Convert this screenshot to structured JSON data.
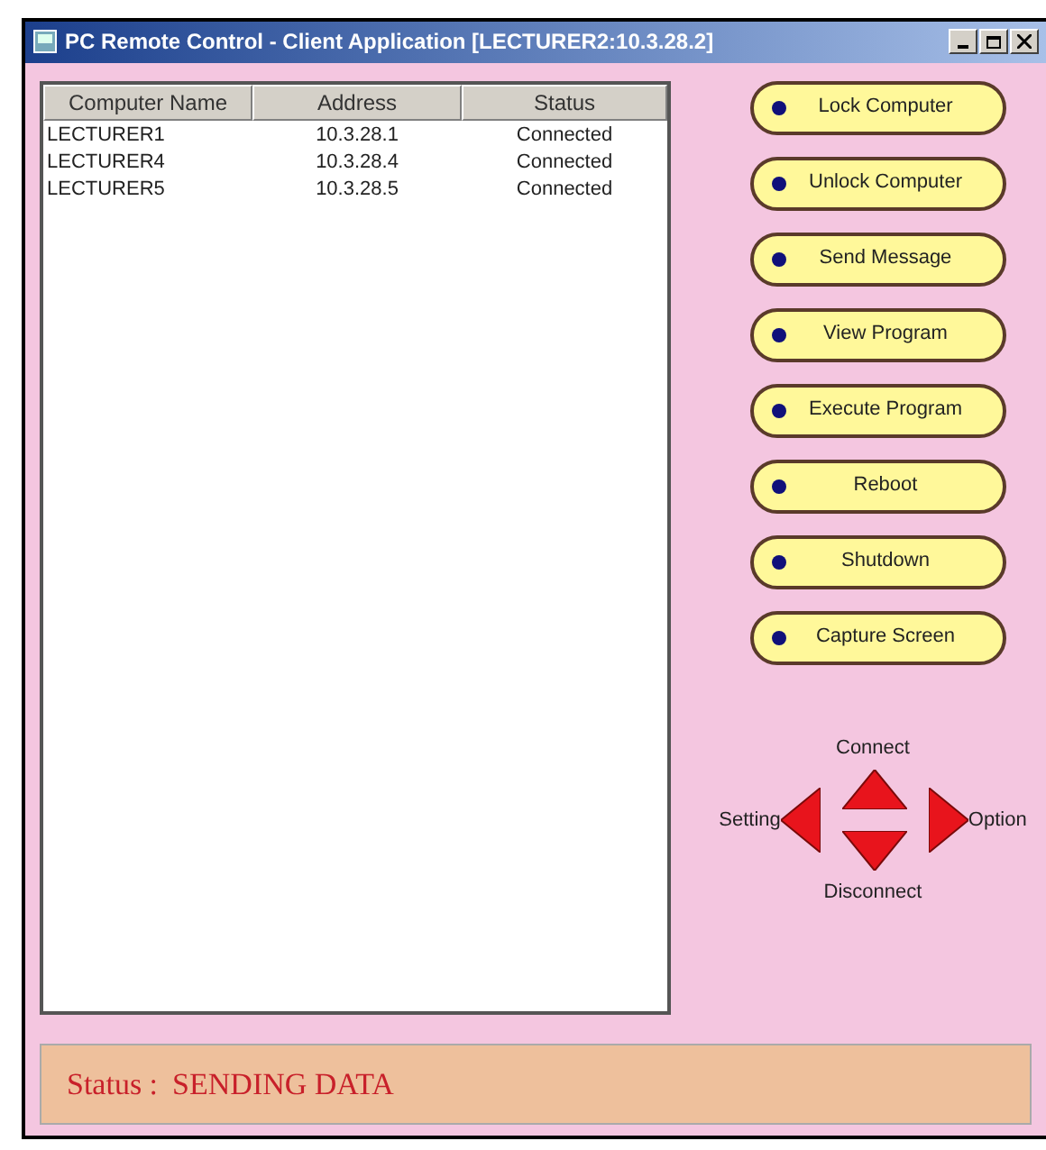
{
  "window": {
    "title": "PC Remote Control  - Client Application [LECTURER2:10.3.28.2]"
  },
  "table": {
    "columns": [
      "Computer Name",
      "Address",
      "Status"
    ],
    "rows": [
      [
        "LECTURER1",
        "10.3.28.1",
        "Connected"
      ],
      [
        "LECTURER4",
        "10.3.28.4",
        "Connected"
      ],
      [
        "LECTURER5",
        "10.3.28.5",
        "Connected"
      ]
    ]
  },
  "actions": [
    "Lock Computer",
    "Unlock Computer",
    "Send Message",
    "View Program",
    "Execute Program",
    "Reboot",
    "Shutdown",
    "Capture Screen"
  ],
  "navigation": {
    "up": "Connect",
    "left": "Setting",
    "right": "Option",
    "down": "Disconnect"
  },
  "status_bar": {
    "label": "Status :",
    "value": "SENDING DATA"
  }
}
